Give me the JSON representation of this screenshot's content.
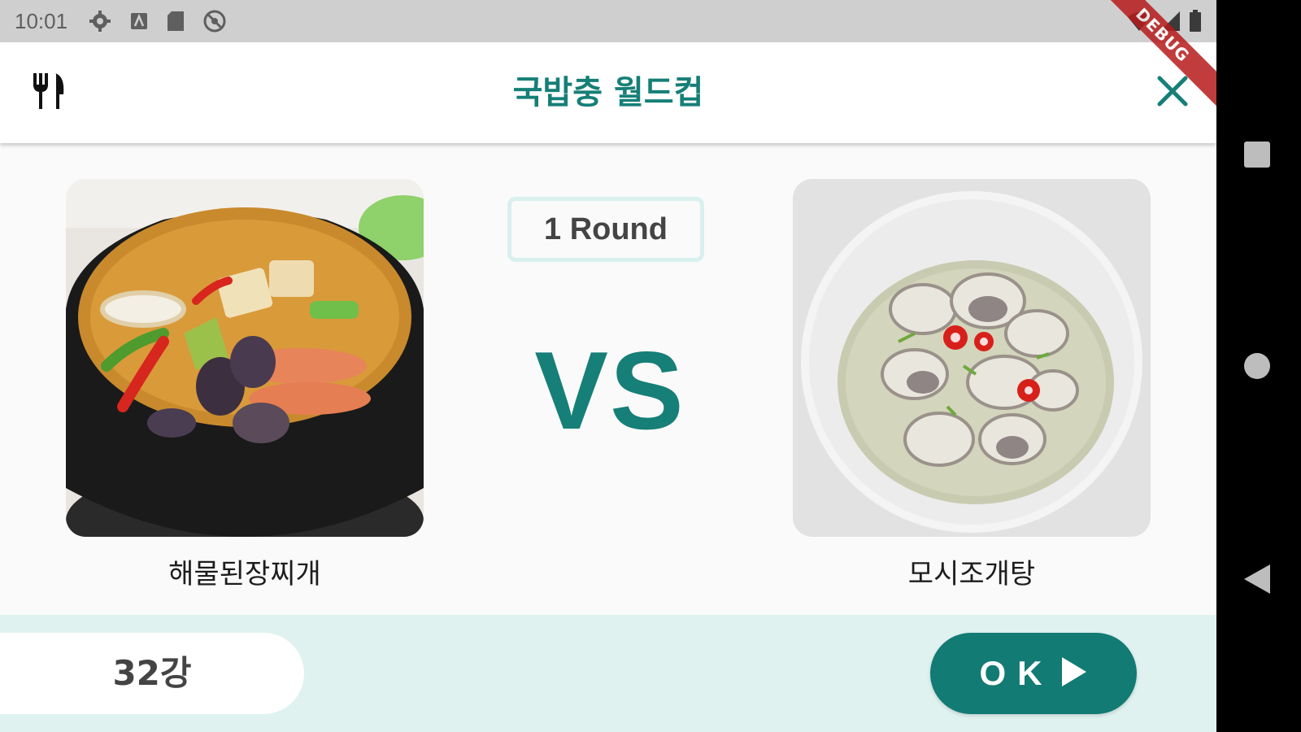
{
  "status_bar": {
    "time": "10:01",
    "icons": [
      "settings-icon",
      "accessibility-icon",
      "sd-card-icon",
      "do-not-disturb-icon",
      "wifi-icon",
      "signal-icon",
      "battery-icon"
    ]
  },
  "debug_banner": "DEBUG",
  "app_bar": {
    "title": "국밥충 월드컵",
    "leading_icon": "fork-knife-icon",
    "trailing_icon": "close-icon"
  },
  "match": {
    "round_label": "1 Round",
    "vs_label": "VS",
    "left": {
      "name": "해물된장찌개"
    },
    "right": {
      "name": "모시조개탕"
    }
  },
  "bottom": {
    "bracket_label": "32강",
    "ok_label": "OK"
  },
  "colors": {
    "accent": "#167f77",
    "panel": "#dff2f0",
    "badge_border": "#d8f0ee"
  },
  "nav_bar": [
    "recents-button",
    "home-button",
    "back-button"
  ]
}
